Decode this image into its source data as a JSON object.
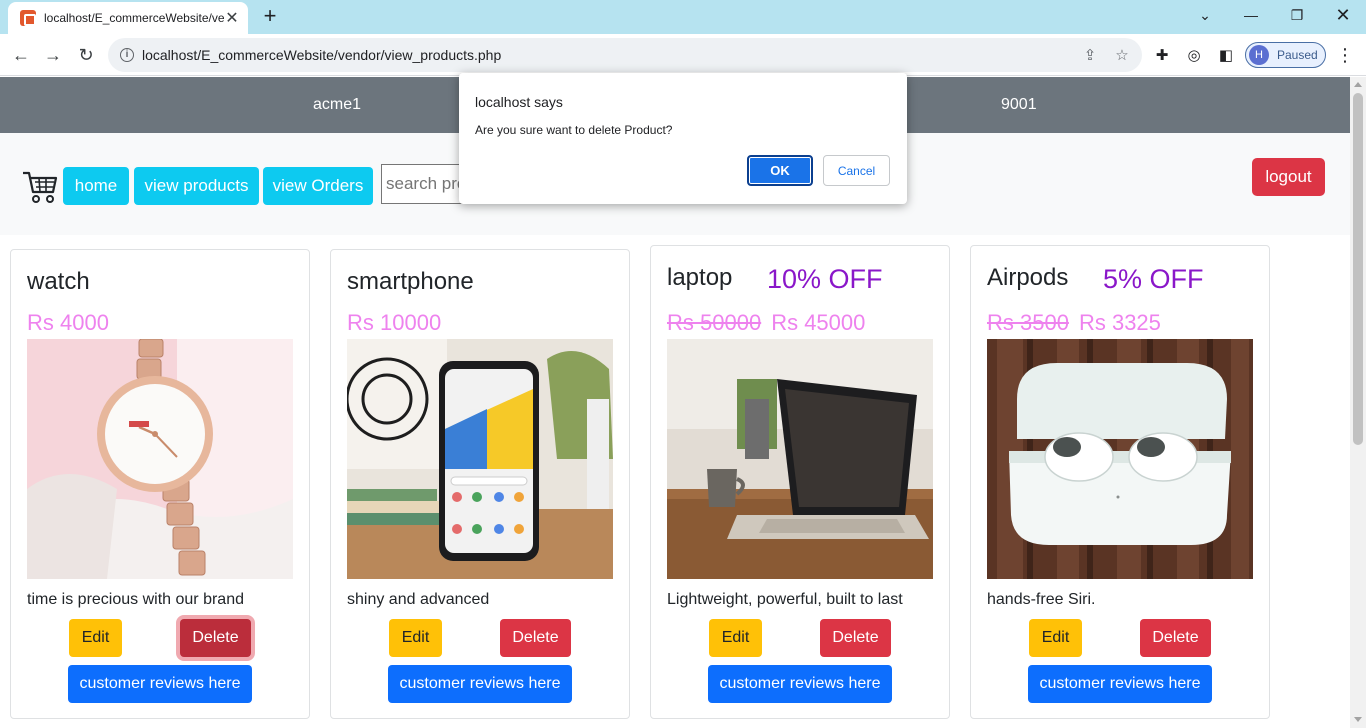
{
  "browser": {
    "tab_title": "localhost/E_commerceWebsite/vendor/view_products.php",
    "url": "localhost/E_commerceWebsite/vendor/view_products.php",
    "profile_initial": "H",
    "profile_status": "Paused"
  },
  "header": {
    "vendor_name": "acme1",
    "vendor_code": "9001"
  },
  "nav": {
    "home": "home",
    "view_products": "view products",
    "view_orders": "view Orders",
    "search_placeholder": "search products",
    "logout": "logout"
  },
  "products": [
    {
      "name": "watch",
      "discount": "",
      "old_price": "",
      "price": "Rs 4000",
      "description": "time is precious with our brand",
      "edit": "Edit",
      "delete": "Delete",
      "reviews": "customer reviews here"
    },
    {
      "name": "smartphone",
      "discount": "",
      "old_price": "",
      "price": "Rs 10000",
      "description": "shiny and advanced",
      "edit": "Edit",
      "delete": "Delete",
      "reviews": "customer reviews here"
    },
    {
      "name": "laptop",
      "discount": "10% OFF",
      "old_price": "Rs 50000",
      "price": "Rs 45000",
      "description": "Lightweight, powerful, built to last",
      "edit": "Edit",
      "delete": "Delete",
      "reviews": "customer reviews here"
    },
    {
      "name": "Airpods",
      "discount": "5% OFF",
      "old_price": "Rs 3500",
      "price": "Rs 3325",
      "description": "hands-free Siri.",
      "edit": "Edit",
      "delete": "Delete",
      "reviews": "customer reviews here"
    }
  ],
  "dialog": {
    "title": "localhost says",
    "message": "Are you sure want to delete Product?",
    "ok": "OK",
    "cancel": "Cancel"
  },
  "colors": {
    "discount": "#8a17c9",
    "price": "#ee82ee",
    "edit": "#ffc107",
    "delete": "#dc3545",
    "reviews": "#0d6efd",
    "nav_button": "#0dcaf0",
    "header_bar": "#6c757d"
  }
}
